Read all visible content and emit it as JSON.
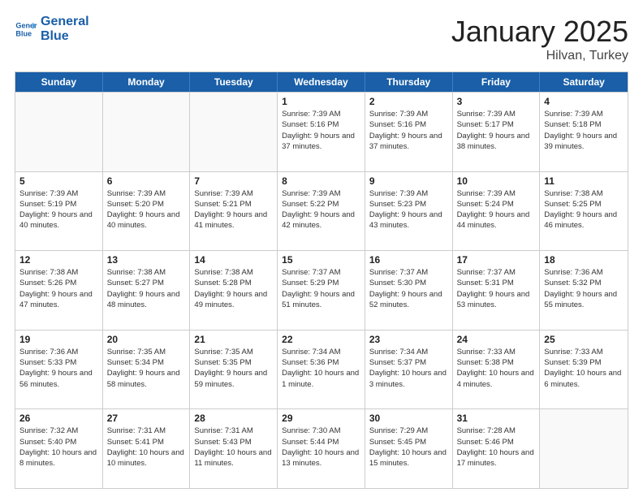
{
  "logo": {
    "line1": "General",
    "line2": "Blue"
  },
  "title": "January 2025",
  "subtitle": "Hilvan, Turkey",
  "days": [
    "Sunday",
    "Monday",
    "Tuesday",
    "Wednesday",
    "Thursday",
    "Friday",
    "Saturday"
  ],
  "weeks": [
    [
      {
        "day": "",
        "text": ""
      },
      {
        "day": "",
        "text": ""
      },
      {
        "day": "",
        "text": ""
      },
      {
        "day": "1",
        "text": "Sunrise: 7:39 AM\nSunset: 5:16 PM\nDaylight: 9 hours\nand 37 minutes."
      },
      {
        "day": "2",
        "text": "Sunrise: 7:39 AM\nSunset: 5:16 PM\nDaylight: 9 hours\nand 37 minutes."
      },
      {
        "day": "3",
        "text": "Sunrise: 7:39 AM\nSunset: 5:17 PM\nDaylight: 9 hours\nand 38 minutes."
      },
      {
        "day": "4",
        "text": "Sunrise: 7:39 AM\nSunset: 5:18 PM\nDaylight: 9 hours\nand 39 minutes."
      }
    ],
    [
      {
        "day": "5",
        "text": "Sunrise: 7:39 AM\nSunset: 5:19 PM\nDaylight: 9 hours\nand 40 minutes."
      },
      {
        "day": "6",
        "text": "Sunrise: 7:39 AM\nSunset: 5:20 PM\nDaylight: 9 hours\nand 40 minutes."
      },
      {
        "day": "7",
        "text": "Sunrise: 7:39 AM\nSunset: 5:21 PM\nDaylight: 9 hours\nand 41 minutes."
      },
      {
        "day": "8",
        "text": "Sunrise: 7:39 AM\nSunset: 5:22 PM\nDaylight: 9 hours\nand 42 minutes."
      },
      {
        "day": "9",
        "text": "Sunrise: 7:39 AM\nSunset: 5:23 PM\nDaylight: 9 hours\nand 43 minutes."
      },
      {
        "day": "10",
        "text": "Sunrise: 7:39 AM\nSunset: 5:24 PM\nDaylight: 9 hours\nand 44 minutes."
      },
      {
        "day": "11",
        "text": "Sunrise: 7:38 AM\nSunset: 5:25 PM\nDaylight: 9 hours\nand 46 minutes."
      }
    ],
    [
      {
        "day": "12",
        "text": "Sunrise: 7:38 AM\nSunset: 5:26 PM\nDaylight: 9 hours\nand 47 minutes."
      },
      {
        "day": "13",
        "text": "Sunrise: 7:38 AM\nSunset: 5:27 PM\nDaylight: 9 hours\nand 48 minutes."
      },
      {
        "day": "14",
        "text": "Sunrise: 7:38 AM\nSunset: 5:28 PM\nDaylight: 9 hours\nand 49 minutes."
      },
      {
        "day": "15",
        "text": "Sunrise: 7:37 AM\nSunset: 5:29 PM\nDaylight: 9 hours\nand 51 minutes."
      },
      {
        "day": "16",
        "text": "Sunrise: 7:37 AM\nSunset: 5:30 PM\nDaylight: 9 hours\nand 52 minutes."
      },
      {
        "day": "17",
        "text": "Sunrise: 7:37 AM\nSunset: 5:31 PM\nDaylight: 9 hours\nand 53 minutes."
      },
      {
        "day": "18",
        "text": "Sunrise: 7:36 AM\nSunset: 5:32 PM\nDaylight: 9 hours\nand 55 minutes."
      }
    ],
    [
      {
        "day": "19",
        "text": "Sunrise: 7:36 AM\nSunset: 5:33 PM\nDaylight: 9 hours\nand 56 minutes."
      },
      {
        "day": "20",
        "text": "Sunrise: 7:35 AM\nSunset: 5:34 PM\nDaylight: 9 hours\nand 58 minutes."
      },
      {
        "day": "21",
        "text": "Sunrise: 7:35 AM\nSunset: 5:35 PM\nDaylight: 9 hours\nand 59 minutes."
      },
      {
        "day": "22",
        "text": "Sunrise: 7:34 AM\nSunset: 5:36 PM\nDaylight: 10 hours\nand 1 minute."
      },
      {
        "day": "23",
        "text": "Sunrise: 7:34 AM\nSunset: 5:37 PM\nDaylight: 10 hours\nand 3 minutes."
      },
      {
        "day": "24",
        "text": "Sunrise: 7:33 AM\nSunset: 5:38 PM\nDaylight: 10 hours\nand 4 minutes."
      },
      {
        "day": "25",
        "text": "Sunrise: 7:33 AM\nSunset: 5:39 PM\nDaylight: 10 hours\nand 6 minutes."
      }
    ],
    [
      {
        "day": "26",
        "text": "Sunrise: 7:32 AM\nSunset: 5:40 PM\nDaylight: 10 hours\nand 8 minutes."
      },
      {
        "day": "27",
        "text": "Sunrise: 7:31 AM\nSunset: 5:41 PM\nDaylight: 10 hours\nand 10 minutes."
      },
      {
        "day": "28",
        "text": "Sunrise: 7:31 AM\nSunset: 5:43 PM\nDaylight: 10 hours\nand 11 minutes."
      },
      {
        "day": "29",
        "text": "Sunrise: 7:30 AM\nSunset: 5:44 PM\nDaylight: 10 hours\nand 13 minutes."
      },
      {
        "day": "30",
        "text": "Sunrise: 7:29 AM\nSunset: 5:45 PM\nDaylight: 10 hours\nand 15 minutes."
      },
      {
        "day": "31",
        "text": "Sunrise: 7:28 AM\nSunset: 5:46 PM\nDaylight: 10 hours\nand 17 minutes."
      },
      {
        "day": "",
        "text": ""
      }
    ]
  ]
}
